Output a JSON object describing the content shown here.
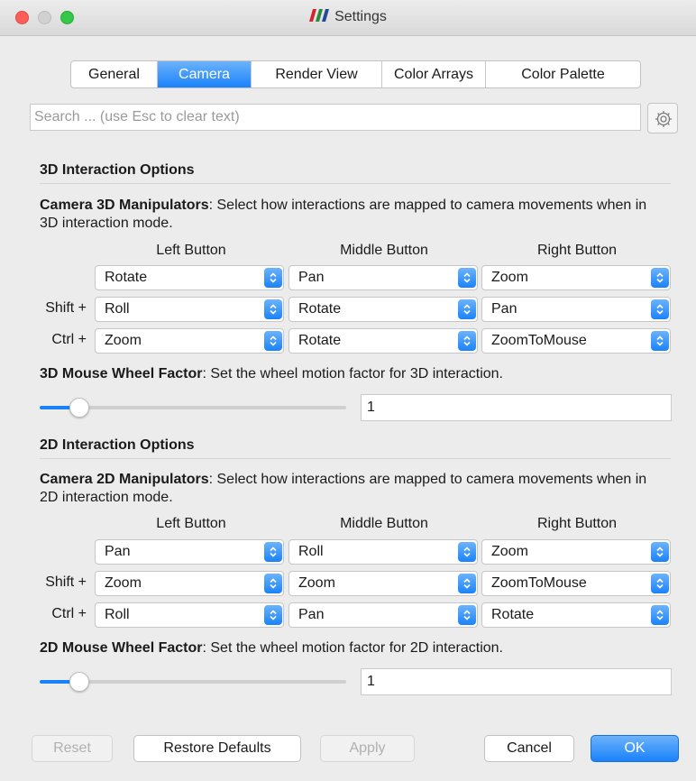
{
  "window": {
    "title": "Settings"
  },
  "tabs": [
    {
      "label": "General",
      "active": false
    },
    {
      "label": "Camera",
      "active": true
    },
    {
      "label": "Render View",
      "active": false
    },
    {
      "label": "Color Arrays",
      "active": false
    },
    {
      "label": "Color Palette",
      "active": false
    }
  ],
  "search": {
    "placeholder": "Search ... (use Esc to clear text)",
    "value": ""
  },
  "icons": {
    "advanced_toggle": "gear-icon",
    "app_logo": "paraview-logo"
  },
  "colors": {
    "accent": "#1a82fb",
    "close": "#fc5f57",
    "maximize": "#34c84a"
  },
  "interaction_3d": {
    "section_title": "3D Interaction Options",
    "manipulators_label": "Camera 3D Manipulators",
    "manipulators_desc": ": Select how interactions are mapped to camera movements when in 3D interaction mode.",
    "columns": [
      "Left Button",
      "Middle Button",
      "Right Button"
    ],
    "rows": [
      {
        "modifier": "",
        "values": [
          "Rotate",
          "Pan",
          "Zoom"
        ]
      },
      {
        "modifier": "Shift +",
        "values": [
          "Roll",
          "Rotate",
          "Pan"
        ]
      },
      {
        "modifier": "Ctrl +",
        "values": [
          "Zoom",
          "Rotate",
          "ZoomToMouse"
        ]
      }
    ],
    "wheel_label": "3D Mouse Wheel Factor",
    "wheel_desc": ": Set the wheel motion factor for 3D interaction.",
    "wheel_value": "1",
    "wheel_slider_fraction": 0.13
  },
  "interaction_2d": {
    "section_title": "2D Interaction Options",
    "manipulators_label": "Camera 2D Manipulators",
    "manipulators_desc": ": Select how interactions are mapped to camera movements when in 2D interaction mode.",
    "columns": [
      "Left Button",
      "Middle Button",
      "Right Button"
    ],
    "rows": [
      {
        "modifier": "",
        "values": [
          "Pan",
          "Roll",
          "Zoom"
        ]
      },
      {
        "modifier": "Shift +",
        "values": [
          "Zoom",
          "Zoom",
          "ZoomToMouse"
        ]
      },
      {
        "modifier": "Ctrl +",
        "values": [
          "Roll",
          "Pan",
          "Rotate"
        ]
      }
    ],
    "wheel_label": "2D Mouse Wheel Factor",
    "wheel_desc": ": Set the wheel motion factor for 2D interaction.",
    "wheel_value": "1",
    "wheel_slider_fraction": 0.13
  },
  "buttons": {
    "reset": {
      "label": "Reset",
      "enabled": false
    },
    "restore_defaults": {
      "label": "Restore Defaults",
      "enabled": true
    },
    "apply": {
      "label": "Apply",
      "enabled": false
    },
    "cancel": {
      "label": "Cancel",
      "enabled": true
    },
    "ok": {
      "label": "OK",
      "enabled": true
    }
  }
}
